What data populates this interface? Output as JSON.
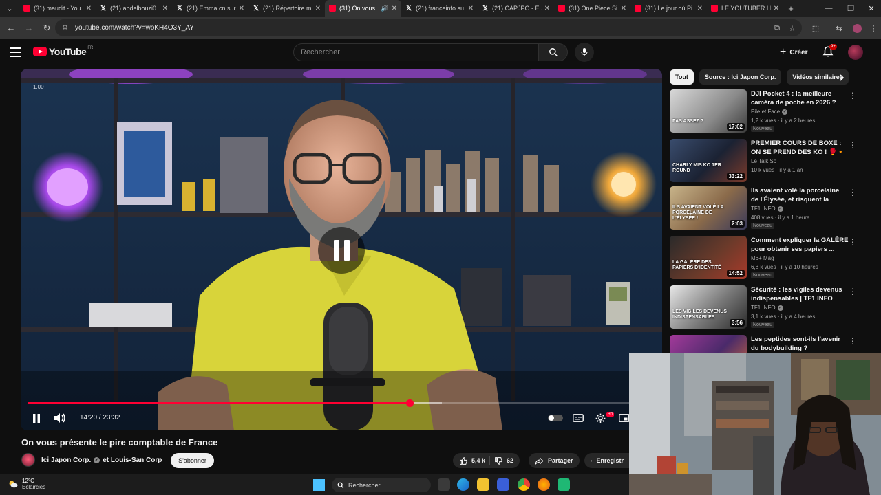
{
  "browser": {
    "tabs": [
      {
        "label": "(31) maudit - You",
        "favicon": "youtube-icon",
        "active": false
      },
      {
        "label": "(21) abdelbouzi0",
        "favicon": "x-icon",
        "active": false
      },
      {
        "label": "(21) Emma cn sur",
        "favicon": "x-icon",
        "active": false
      },
      {
        "label": "(21) Répertoire m",
        "favicon": "x-icon",
        "active": false
      },
      {
        "label": "(31) On vous",
        "favicon": "youtube-icon",
        "active": true,
        "audio": true
      },
      {
        "label": "(21) franceinfo su",
        "favicon": "x-icon",
        "active": false
      },
      {
        "label": "(21) CAPJPO - Eu",
        "favicon": "x-icon",
        "active": false
      },
      {
        "label": "(31) One Piece Si",
        "favicon": "youtube-icon",
        "active": false
      },
      {
        "label": "(31) Le jour où Pi",
        "favicon": "youtube-icon",
        "active": false
      },
      {
        "label": "LE YOUTUBER LE",
        "favicon": "youtube-icon",
        "active": false
      }
    ],
    "url": "youtube.com/watch?v=woKH4O3Y_AY"
  },
  "youtube": {
    "logo_text": "YouTube",
    "country_code": "FR",
    "search_placeholder": "Rechercher",
    "create_label": "Créer",
    "notification_count": "9+"
  },
  "player": {
    "playback_rate": "1.00",
    "current_time": "14:20",
    "duration": "23:32",
    "time_display": "14:20 / 23:32",
    "progress_fraction": 0.609,
    "buffer_fraction": 0.66,
    "state": "playing"
  },
  "video": {
    "title": "On vous présente le pire comptable de France",
    "channel": "Ici Japon Corp.",
    "channel_suffix": "et Louis-San Corp",
    "subscribe_label": "S'abonner",
    "likes": "5,4 k",
    "dislikes": "62",
    "share_label": "Partager",
    "save_label": "Enregistr"
  },
  "chips": [
    {
      "label": "Tout",
      "active": true
    },
    {
      "label": "Source : Ici Japon Corp.",
      "active": false
    },
    {
      "label": "Vidéos similaires",
      "active": false
    }
  ],
  "recommendations": [
    {
      "title": "DJI Pocket 4 : la meilleure caméra de poche en 2026 ?",
      "channel": "Pile et Face",
      "verified": true,
      "meta": "1,2 k vues · il y a 2 heures",
      "badge": "Nouveau",
      "duration": "17:02",
      "thumb_text": "PAS ASSEZ ?"
    },
    {
      "title": "PREMIER COURS DE BOXE : ON SE PREND DES KO ! 🥊🔸",
      "channel": "Le Talk So",
      "verified": false,
      "meta": "10 k vues · il y a 1 an",
      "badge": "",
      "duration": "33:22",
      "thumb_text": "CHARLY MIS KO 1ER ROUND"
    },
    {
      "title": "Ils avaient volé la porcelaine de l'Élysée, et risquent la prison !...",
      "channel": "TF1 INFO",
      "verified": true,
      "meta": "408 vues · il y a 1 heure",
      "badge": "Nouveau",
      "duration": "2:03",
      "thumb_text": "ILS AVAIENT VOLÉ LA PORCELAINE DE L'ÉLYSÉE !"
    },
    {
      "title": "Comment expliquer la GALÈRE pour obtenir ses papiers ...",
      "channel": "M6+ Mag",
      "verified": false,
      "meta": "6,8 k vues · il y a 10 heures",
      "badge": "Nouveau",
      "duration": "14:52",
      "thumb_text": "LA GALÈRE DES PAPIERS D'IDENTITÉ"
    },
    {
      "title": "Sécurité : les vigiles devenus indispensables | TF1 INFO",
      "channel": "TF1 INFO",
      "verified": true,
      "meta": "3,1 k vues · il y a 4 heures",
      "badge": "Nouveau",
      "duration": "3:56",
      "thumb_text": "LES VIGILES DEVENUS INDISPENSABLES"
    },
    {
      "title": "Les peptides sont-ils l'avenir du bodybuilding ?",
      "channel": "",
      "verified": false,
      "meta": "",
      "badge": "",
      "duration": "",
      "thumb_text": ""
    }
  ],
  "taskbar": {
    "temperature": "12°C",
    "condition": "Eclaircies",
    "search_label": "Rechercher"
  },
  "colors": {
    "accent": "#ff0033",
    "background": "#0f0f0f",
    "chip_bg": "#272727",
    "text": "#f1f1f1",
    "secondary_text": "#aaaaaa"
  }
}
